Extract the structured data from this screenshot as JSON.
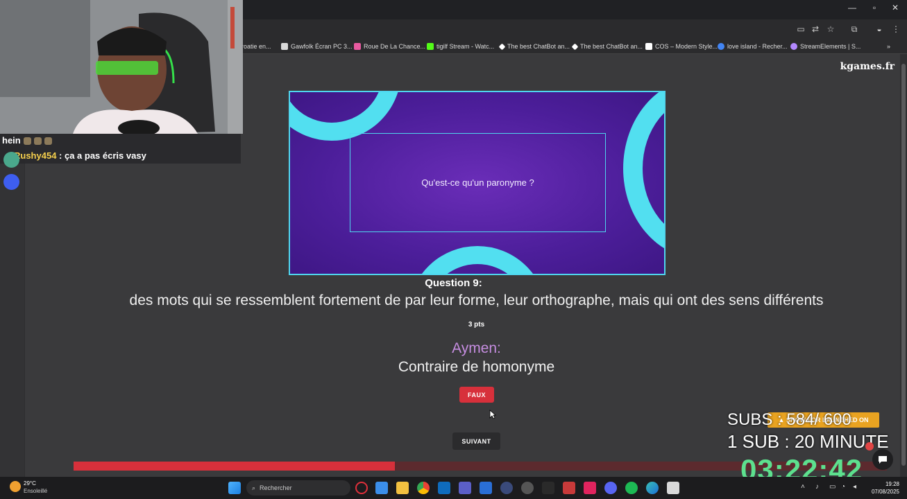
{
  "browser": {
    "bookmarks": [
      {
        "label": "roatie en...",
        "color": "#888888"
      },
      {
        "label": "Gawfolk Écran PC 3...",
        "color": "#d9d9d9"
      },
      {
        "label": "Roue De La Chance...",
        "color": "#e85aa0"
      },
      {
        "label": "tigilf Stream - Watc...",
        "color": "#53fc18"
      },
      {
        "label": "The best ChatBot an...",
        "color": "#ffffff"
      },
      {
        "label": "The best ChatBot an...",
        "color": "#ffffff"
      },
      {
        "label": "COS – Modern Style...",
        "color": "#ffffff"
      },
      {
        "label": "love island - Recher...",
        "color": "#4285f4"
      },
      {
        "label": "StreamElements | S...",
        "color": "#b388ff"
      }
    ]
  },
  "site": {
    "brand": "kgames.fr"
  },
  "quiz": {
    "question_card_text": "Qu'est-ce qu'un paronyme ?",
    "question_number": "Question 9:",
    "correct_answer": "des mots qui se ressemblent fortement de par leur forme, leur orthographe, mais qui ont des sens différents",
    "points": "3 pts",
    "player_name": "Aymen:",
    "player_answer": "Contraire de homonyme",
    "result_label": "FAUX",
    "next_label": "SUIVANT",
    "timer_progress": 0.395
  },
  "stream": {
    "chat": [
      {
        "user": "",
        "message": "hein"
      },
      {
        "user": "Rushy454",
        "message": " : ça a pas écris vasy"
      }
    ],
    "subs_banner": "▲ SHOW FOR LAUNCHED ON",
    "subs_count": "SUBS : 584/ 600",
    "sub_rate": "1 SUB : 20 MINUTE",
    "timer": "03:22:42"
  },
  "taskbar": {
    "temperature": "29°C",
    "weather": "Ensoleillé",
    "search_placeholder": "Rechercher",
    "time": "19:28",
    "date": "07/08/2025"
  }
}
